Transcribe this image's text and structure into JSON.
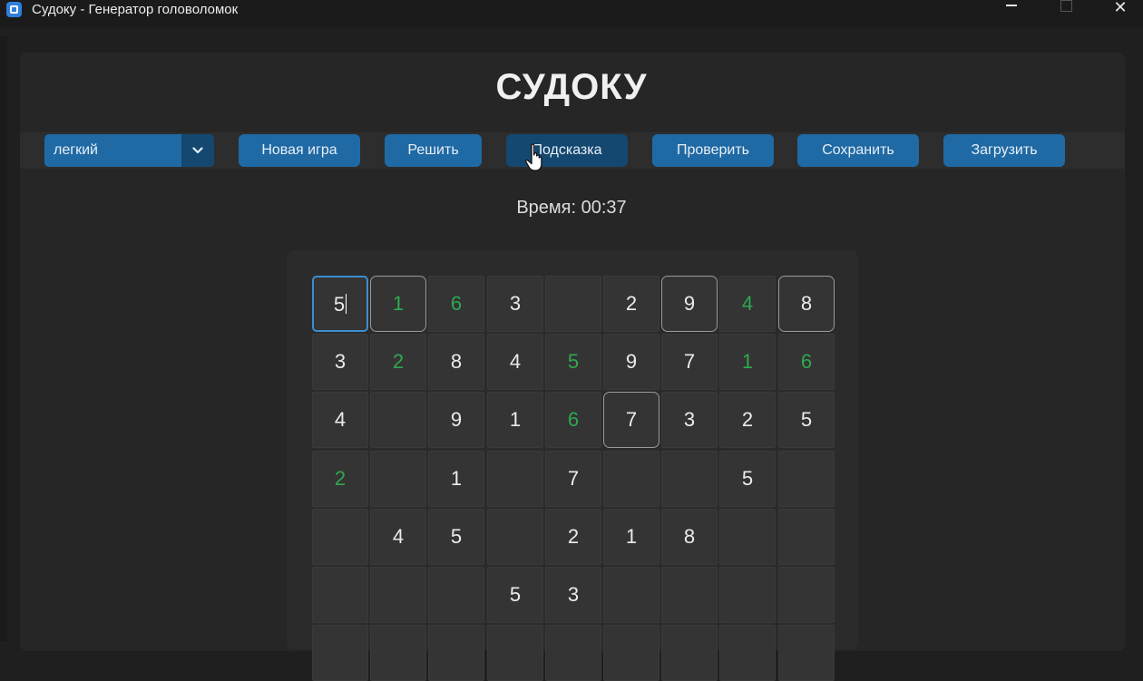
{
  "window": {
    "title": "Судоку - Генератор головоломок",
    "controls": {
      "minimize": "—",
      "maximize": "□",
      "close": "✕"
    }
  },
  "app": {
    "title": "СУДОКУ",
    "timer": "Время: 00:37"
  },
  "toolbar": {
    "difficulty_value": "легкий",
    "buttons": {
      "new_game": "Новая игра",
      "solve": "Решить",
      "hint": "Подсказка",
      "check": "Проверить",
      "save": "Сохранить",
      "load": "Загрузить"
    }
  },
  "colors": {
    "accent": "#1f6aa5",
    "accent_dark": "#144870",
    "user_digit": "#2fa84f",
    "given_digit": "#ececec",
    "selected_border": "#3b8ed0"
  },
  "board": {
    "selected_cell": [
      0,
      0
    ],
    "highlighted_cells": [
      [
        0,
        1
      ],
      [
        0,
        6
      ],
      [
        0,
        8
      ],
      [
        2,
        5
      ]
    ],
    "rows": [
      [
        {
          "v": "5",
          "t": "given"
        },
        {
          "v": "1",
          "t": "user"
        },
        {
          "v": "6",
          "t": "user"
        },
        {
          "v": "3",
          "t": "given"
        },
        {
          "v": "",
          "t": "empty"
        },
        {
          "v": "2",
          "t": "given"
        },
        {
          "v": "9",
          "t": "given"
        },
        {
          "v": "4",
          "t": "user"
        },
        {
          "v": "8",
          "t": "given"
        }
      ],
      [
        {
          "v": "3",
          "t": "given"
        },
        {
          "v": "2",
          "t": "user"
        },
        {
          "v": "8",
          "t": "given"
        },
        {
          "v": "4",
          "t": "given"
        },
        {
          "v": "5",
          "t": "user"
        },
        {
          "v": "9",
          "t": "given"
        },
        {
          "v": "7",
          "t": "given"
        },
        {
          "v": "1",
          "t": "user"
        },
        {
          "v": "6",
          "t": "user"
        }
      ],
      [
        {
          "v": "4",
          "t": "given"
        },
        {
          "v": "",
          "t": "empty"
        },
        {
          "v": "9",
          "t": "given"
        },
        {
          "v": "1",
          "t": "given"
        },
        {
          "v": "6",
          "t": "user"
        },
        {
          "v": "7",
          "t": "given"
        },
        {
          "v": "3",
          "t": "given"
        },
        {
          "v": "2",
          "t": "given"
        },
        {
          "v": "5",
          "t": "given"
        }
      ],
      [
        {
          "v": "2",
          "t": "user"
        },
        {
          "v": "",
          "t": "empty"
        },
        {
          "v": "1",
          "t": "given"
        },
        {
          "v": "",
          "t": "empty"
        },
        {
          "v": "7",
          "t": "given"
        },
        {
          "v": "",
          "t": "empty"
        },
        {
          "v": "",
          "t": "empty"
        },
        {
          "v": "5",
          "t": "given"
        },
        {
          "v": "",
          "t": "empty"
        }
      ],
      [
        {
          "v": "",
          "t": "empty"
        },
        {
          "v": "4",
          "t": "given"
        },
        {
          "v": "5",
          "t": "given"
        },
        {
          "v": "",
          "t": "empty"
        },
        {
          "v": "2",
          "t": "given"
        },
        {
          "v": "1",
          "t": "given"
        },
        {
          "v": "8",
          "t": "given"
        },
        {
          "v": "",
          "t": "empty"
        },
        {
          "v": "",
          "t": "empty"
        }
      ],
      [
        {
          "v": "",
          "t": "empty"
        },
        {
          "v": "",
          "t": "empty"
        },
        {
          "v": "",
          "t": "empty"
        },
        {
          "v": "5",
          "t": "given"
        },
        {
          "v": "3",
          "t": "given"
        },
        {
          "v": "",
          "t": "empty"
        },
        {
          "v": "",
          "t": "empty"
        },
        {
          "v": "",
          "t": "empty"
        },
        {
          "v": "",
          "t": "empty"
        }
      ],
      [
        {
          "v": "",
          "t": "empty"
        },
        {
          "v": "",
          "t": "empty"
        },
        {
          "v": "",
          "t": "empty"
        },
        {
          "v": "",
          "t": "empty"
        },
        {
          "v": "",
          "t": "empty"
        },
        {
          "v": "",
          "t": "empty"
        },
        {
          "v": "",
          "t": "empty"
        },
        {
          "v": "",
          "t": "empty"
        },
        {
          "v": "",
          "t": "empty"
        }
      ]
    ]
  }
}
